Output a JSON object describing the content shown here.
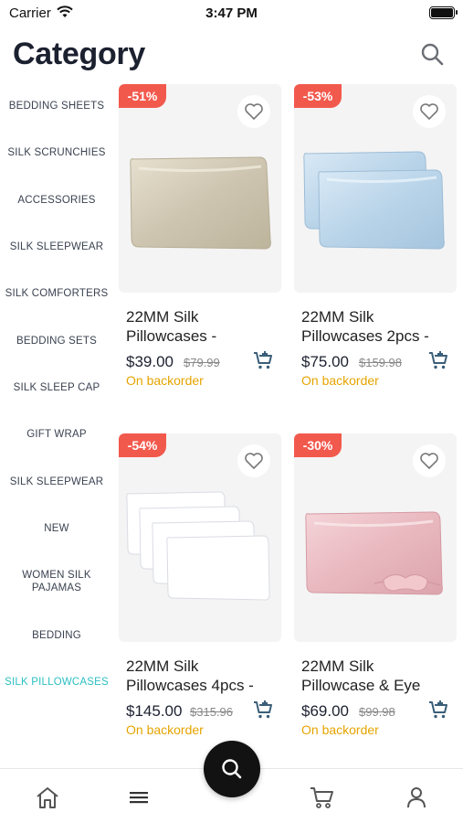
{
  "status_bar": {
    "carrier": "Carrier",
    "time": "3:47 PM"
  },
  "header": {
    "title": "Category"
  },
  "sidebar": {
    "items": [
      {
        "label": "BEDDING SHEETS"
      },
      {
        "label": "SILK SCRUNCHIES"
      },
      {
        "label": "ACCESSORIES"
      },
      {
        "label": "SILK SLEEPWEAR"
      },
      {
        "label": "SILK COMFORTERS"
      },
      {
        "label": "BEDDING SETS"
      },
      {
        "label": "SILK SLEEP CAP"
      },
      {
        "label": "GIFT WRAP"
      },
      {
        "label": "SILK SLEEPWEAR"
      },
      {
        "label": "NEW"
      },
      {
        "label": "WOMEN SILK PAJAMAS"
      },
      {
        "label": "BEDDING"
      },
      {
        "label": "SILK PILLOWCASES"
      }
    ],
    "active_index": 12,
    "active_color": "#2cbfc2"
  },
  "products": [
    {
      "discount": "-51%",
      "title_line1": "22MM Silk",
      "title_line2": "Pillowcases -",
      "price": "$39.00",
      "old_price": "$79.99",
      "stock": "On backorder"
    },
    {
      "discount": "-53%",
      "title_line1": "22MM Silk",
      "title_line2": "Pillowcases 2pcs -",
      "price": "$75.00",
      "old_price": "$159.98",
      "stock": "On backorder"
    },
    {
      "discount": "-54%",
      "title_line1": "22MM Silk",
      "title_line2": "Pillowcases 4pcs -",
      "price": "$145.00",
      "old_price": "$315.96",
      "stock": "On backorder"
    },
    {
      "discount": "-30%",
      "title_line1": "22MM Silk",
      "title_line2": "Pillowcase & Eye",
      "price": "$69.00",
      "old_price": "$99.98",
      "stock": "On backorder"
    }
  ],
  "colors": {
    "badge": "#f2594d",
    "stock": "#e5a400",
    "fab": "#121212"
  },
  "icons": {
    "search": "search-icon",
    "heart": "heart-icon",
    "cart_add": "cart-add-icon",
    "home": "home-icon",
    "menu": "menu-icon",
    "cart": "cart-icon",
    "user": "user-icon"
  }
}
